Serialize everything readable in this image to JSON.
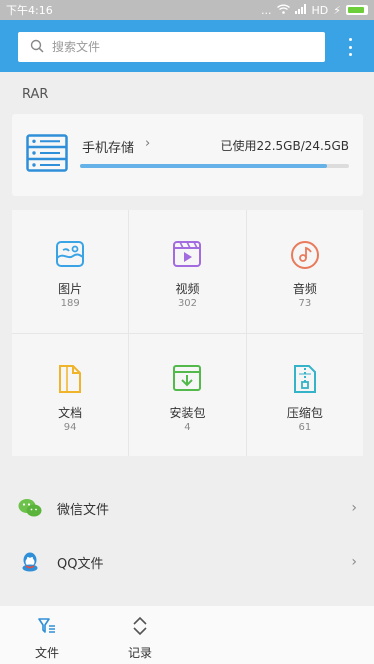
{
  "status_bar": {
    "time": "下午4:16",
    "dots": "...",
    "network": "HD",
    "charge": "⚡"
  },
  "search": {
    "placeholder": "搜索文件"
  },
  "section": {
    "title": "RAR"
  },
  "storage": {
    "label": "手机存储",
    "chevron": "›",
    "usage": "已使用22.5GB/24.5GB",
    "used_fraction": 0.918
  },
  "categories": [
    {
      "label": "图片",
      "count": "189"
    },
    {
      "label": "视频",
      "count": "302"
    },
    {
      "label": "音频",
      "count": "73"
    },
    {
      "label": "文档",
      "count": "94"
    },
    {
      "label": "安装包",
      "count": "4"
    },
    {
      "label": "压缩包",
      "count": "61"
    }
  ],
  "list": [
    {
      "label": "微信文件",
      "chevron": "›"
    },
    {
      "label": "QQ文件",
      "chevron": "›"
    }
  ],
  "tabs": [
    {
      "label": "文件"
    },
    {
      "label": "记录"
    }
  ],
  "colors": {
    "accent": "#3aa3e6",
    "storage_bar": "#65b2e8"
  }
}
